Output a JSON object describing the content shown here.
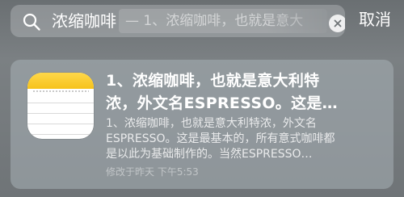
{
  "search": {
    "query": "浓缩咖啡",
    "suggestion": "— 1、浓缩咖啡，也就是意大",
    "cancel_label": "取消"
  },
  "result": {
    "app_icon": "notes-icon",
    "title_line1": "1、浓缩咖啡，也就是意大利特",
    "title_line2": "浓，外文名ESPRESSO。这是…",
    "body_line1": "1、浓缩咖啡，也就是意大利特浓，外文名",
    "body_line2": "ESPRESSO。这是最基本的，所有意式咖啡都",
    "body_line3": "是以此为基础制作的。当然ESPRESSO…",
    "modified": "修改于昨天 下午5:53"
  },
  "colors": {
    "notes_yellow": "#f6c21a",
    "text": "#ffffff"
  }
}
